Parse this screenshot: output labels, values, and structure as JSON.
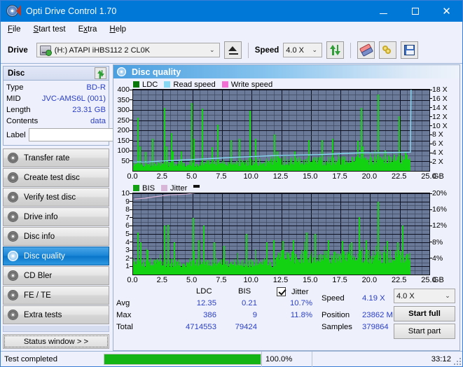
{
  "window": {
    "title": "Opti Drive Control 1.70",
    "icon": "disc-icon",
    "minimize": "—",
    "maximize": "▢",
    "close": "✕"
  },
  "menu": {
    "items": [
      {
        "label": "File",
        "accel": "F"
      },
      {
        "label": "Start test",
        "accel": "S"
      },
      {
        "label": "Extra",
        "accel": "x"
      },
      {
        "label": "Help",
        "accel": "H"
      }
    ]
  },
  "toolbar": {
    "drive_label": "Drive",
    "drive_value": "(H:)   ATAPI iHBS112  2 CL0K",
    "eject_title": "eject-button",
    "speed_label": "Speed",
    "speed_value": "4.0 X",
    "refresh_title": "refresh-button",
    "erase_title": "erase-button",
    "key_title": "key-button",
    "save_title": "save-button",
    "chevron": "⌄"
  },
  "disc_panel": {
    "title": "Disc",
    "refresh_title": "refresh-disc-button",
    "rows": [
      {
        "key": "Type",
        "value": "BD-R"
      },
      {
        "key": "MID",
        "value": "JVC-AMS6L (001)"
      },
      {
        "key": "Length",
        "value": "23.31 GB"
      },
      {
        "key": "Contents",
        "value": "data"
      }
    ],
    "label_key": "Label",
    "label_value": "",
    "label_placeholder": "",
    "label_button": "disc-label-button"
  },
  "sidebar": {
    "items": [
      {
        "label": "Transfer rate",
        "active": false
      },
      {
        "label": "Create test disc",
        "active": false
      },
      {
        "label": "Verify test disc",
        "active": false
      },
      {
        "label": "Drive info",
        "active": false
      },
      {
        "label": "Disc info",
        "active": false
      },
      {
        "label": "Disc quality",
        "active": true
      },
      {
        "label": "CD Bler",
        "active": false
      },
      {
        "label": "FE / TE",
        "active": false
      },
      {
        "label": "Extra tests",
        "active": false
      }
    ],
    "status_window": "Status window > >"
  },
  "main": {
    "title": "Disc quality",
    "legend_top": [
      {
        "label": "LDC",
        "color": "#087808"
      },
      {
        "label": "Read speed",
        "color": "#86d8f2"
      },
      {
        "label": "Write speed",
        "color": "#f36fd3"
      }
    ],
    "legend_bottom": [
      {
        "label": "BIS",
        "color": "#13a113"
      },
      {
        "label": "Jitter",
        "color": "#d8b6d8"
      }
    ]
  },
  "stats": {
    "col_headers": [
      "LDC",
      "BIS"
    ],
    "row_headers": [
      "Avg",
      "Max",
      "Total"
    ],
    "ldc": {
      "avg": "12.35",
      "max": "386",
      "total": "4714553"
    },
    "bis": {
      "avg": "0.21",
      "max": "9",
      "total": "79424"
    },
    "jitter": {
      "label": "Jitter",
      "checked": true,
      "avg": "10.7%",
      "max": "11.8%"
    },
    "speed_label": "Speed",
    "speed_value": "4.19 X",
    "position_label": "Position",
    "position_value": "23862 MB",
    "samples_label": "Samples",
    "samples_value": "379864",
    "speed_select": "4.0 X",
    "start_full": "Start full",
    "start_part": "Start part"
  },
  "statusbar": {
    "message": "Test completed",
    "progress_pct": 100.0,
    "progress_text": "100.0%",
    "elapsed": "33:12"
  },
  "chart_data": [
    {
      "type": "bar",
      "name": "top-chart",
      "title": "Disc quality - LDC / Read speed",
      "xlabel": "GB",
      "ylabel": "LDC",
      "xlim": [
        0,
        25
      ],
      "xticks": [
        "0.0",
        "2.5",
        "5.0",
        "7.5",
        "10.0",
        "12.5",
        "15.0",
        "17.5",
        "20.0",
        "22.5",
        "25.0"
      ],
      "xunit": "GB",
      "ylim": [
        0,
        400
      ],
      "yticks": [
        50,
        100,
        150,
        200,
        250,
        300,
        350,
        400
      ],
      "y2lim": [
        0,
        18
      ],
      "y2ticks": [
        "2 X",
        "4 X",
        "6 X",
        "8 X",
        "10 X",
        "12 X",
        "14 X",
        "16 X",
        "18 X"
      ],
      "grid": true,
      "series": [
        {
          "name": "LDC",
          "color": "#12d212",
          "type": "bar",
          "note": "dense noise floor ~20-60 across 0-23.4 GB with sparse tall spikes",
          "baseline": 35,
          "spikes": [
            {
              "x": 0.35,
              "y": 262
            },
            {
              "x": 0.5,
              "y": 120
            },
            {
              "x": 1.0,
              "y": 95
            },
            {
              "x": 1.6,
              "y": 158
            },
            {
              "x": 2.6,
              "y": 312
            },
            {
              "x": 2.75,
              "y": 120
            },
            {
              "x": 3.2,
              "y": 188
            },
            {
              "x": 3.3,
              "y": 96
            },
            {
              "x": 4.0,
              "y": 97
            },
            {
              "x": 4.9,
              "y": 334
            },
            {
              "x": 5.1,
              "y": 160
            },
            {
              "x": 5.8,
              "y": 308
            },
            {
              "x": 6.6,
              "y": 118
            },
            {
              "x": 7.1,
              "y": 228
            },
            {
              "x": 8.2,
              "y": 151
            },
            {
              "x": 8.9,
              "y": 160
            },
            {
              "x": 9.8,
              "y": 295
            },
            {
              "x": 10.3,
              "y": 160
            },
            {
              "x": 11.9,
              "y": 181
            },
            {
              "x": 12.1,
              "y": 97
            },
            {
              "x": 13.6,
              "y": 97
            },
            {
              "x": 14.8,
              "y": 151
            },
            {
              "x": 15.9,
              "y": 151
            },
            {
              "x": 16.8,
              "y": 160
            },
            {
              "x": 18.9,
              "y": 150
            },
            {
              "x": 19.2,
              "y": 310
            },
            {
              "x": 19.3,
              "y": 120
            },
            {
              "x": 20.6,
              "y": 376
            },
            {
              "x": 21.2,
              "y": 100
            },
            {
              "x": 22.4,
              "y": 268
            },
            {
              "x": 22.9,
              "y": 90
            }
          ]
        },
        {
          "name": "Read speed",
          "color": "#86d8f2",
          "type": "line",
          "points": [
            {
              "x": 0.0,
              "y": 2.0
            },
            {
              "x": 1.2,
              "y": 2.0
            },
            {
              "x": 2.6,
              "y": 2.2
            },
            {
              "x": 4.0,
              "y": 2.4
            },
            {
              "x": 5.6,
              "y": 2.6
            },
            {
              "x": 7.0,
              "y": 2.8
            },
            {
              "x": 8.4,
              "y": 3.0
            },
            {
              "x": 10.2,
              "y": 3.2
            },
            {
              "x": 12.0,
              "y": 3.4
            },
            {
              "x": 13.8,
              "y": 3.5
            },
            {
              "x": 15.6,
              "y": 3.6
            },
            {
              "x": 17.4,
              "y": 3.8
            },
            {
              "x": 19.2,
              "y": 4.0
            },
            {
              "x": 21.0,
              "y": 4.05
            },
            {
              "x": 22.6,
              "y": 4.1
            },
            {
              "x": 23.4,
              "y": 4.15
            },
            {
              "x": 23.45,
              "y": 18.0
            }
          ]
        },
        {
          "name": "Write speed",
          "color": "#f36fd3",
          "type": "line",
          "points": []
        }
      ]
    },
    {
      "type": "bar",
      "name": "bottom-chart",
      "title": "Disc quality - BIS / Jitter",
      "xlabel": "GB",
      "ylabel": "BIS",
      "xlim": [
        0,
        25
      ],
      "xticks": [
        "0.0",
        "2.5",
        "5.0",
        "7.5",
        "10.0",
        "12.5",
        "15.0",
        "17.5",
        "20.0",
        "22.5",
        "25.0"
      ],
      "xunit": "GB",
      "ylim": [
        0,
        10
      ],
      "yticks": [
        1,
        2,
        3,
        4,
        5,
        6,
        7,
        8,
        9,
        10
      ],
      "y2lim": [
        0,
        20
      ],
      "y2ticks": [
        "4%",
        "8%",
        "12%",
        "16%",
        "20%"
      ],
      "grid": true,
      "series": [
        {
          "name": "BIS",
          "color": "#12d212",
          "type": "bar",
          "note": "dense fill to ~2 rising to ~3 after 12 GB, sparse spikes to 4-9",
          "baseline": 2,
          "spikes": [
            {
              "x": 0.35,
              "y": 5.2
            },
            {
              "x": 0.6,
              "y": 4.0
            },
            {
              "x": 1.2,
              "y": 3.0
            },
            {
              "x": 2.6,
              "y": 6.0
            },
            {
              "x": 2.9,
              "y": 6.1
            },
            {
              "x": 3.4,
              "y": 4.0
            },
            {
              "x": 5.0,
              "y": 7.0
            },
            {
              "x": 5.5,
              "y": 4.2
            },
            {
              "x": 5.9,
              "y": 6.0
            },
            {
              "x": 6.8,
              "y": 4.0
            },
            {
              "x": 7.6,
              "y": 3.5
            },
            {
              "x": 9.5,
              "y": 5.0
            },
            {
              "x": 11.2,
              "y": 4.0
            },
            {
              "x": 11.8,
              "y": 4.2
            },
            {
              "x": 12.6,
              "y": 4.1
            },
            {
              "x": 13.5,
              "y": 4.2
            },
            {
              "x": 14.6,
              "y": 5.2
            },
            {
              "x": 15.3,
              "y": 5.0
            },
            {
              "x": 16.4,
              "y": 4.2
            },
            {
              "x": 17.6,
              "y": 4.1
            },
            {
              "x": 18.4,
              "y": 4.0
            },
            {
              "x": 19.0,
              "y": 7.1
            },
            {
              "x": 19.6,
              "y": 4.2
            },
            {
              "x": 20.6,
              "y": 9.0
            },
            {
              "x": 21.4,
              "y": 4.1
            },
            {
              "x": 22.3,
              "y": 4.0
            },
            {
              "x": 22.7,
              "y": 6.0
            }
          ]
        },
        {
          "name": "Jitter",
          "color": "#d8b6d8",
          "type": "line",
          "points": [
            {
              "x": 0.1,
              "y": 9.3
            },
            {
              "x": 1.0,
              "y": 9.4
            },
            {
              "x": 2.0,
              "y": 9.6
            },
            {
              "x": 3.0,
              "y": 9.8
            },
            {
              "x": 4.5,
              "y": 9.9
            },
            {
              "x": 6.0,
              "y": 10.2
            },
            {
              "x": 7.2,
              "y": 10.6
            },
            {
              "x": 8.5,
              "y": 10.8
            },
            {
              "x": 10.0,
              "y": 11.0
            },
            {
              "x": 11.5,
              "y": 11.3
            },
            {
              "x": 13.0,
              "y": 11.4
            },
            {
              "x": 14.5,
              "y": 11.5
            },
            {
              "x": 16.0,
              "y": 11.4
            },
            {
              "x": 17.5,
              "y": 11.4
            },
            {
              "x": 19.0,
              "y": 11.3
            },
            {
              "x": 20.5,
              "y": 11.3
            },
            {
              "x": 22.0,
              "y": 11.2
            },
            {
              "x": 23.2,
              "y": 10.9
            }
          ]
        }
      ]
    }
  ]
}
